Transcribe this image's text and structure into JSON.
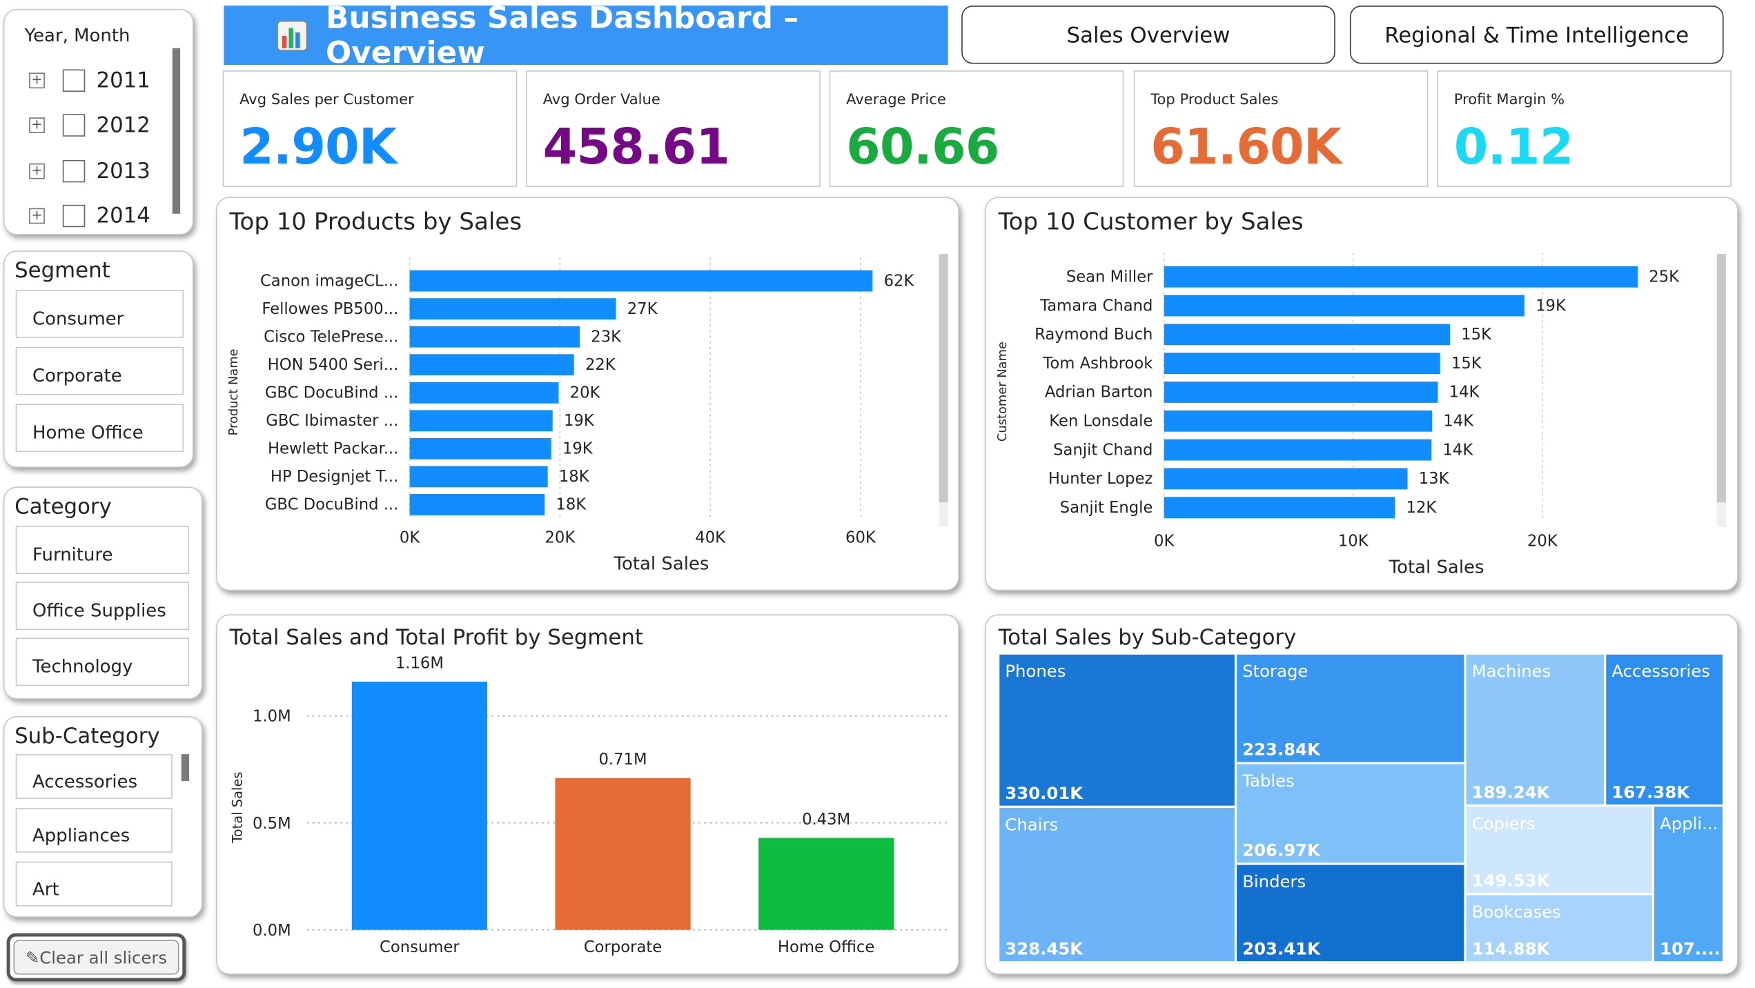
{
  "header": {
    "title": "Business Sales Dashboard – Overview",
    "title_icon": "bar-chart-icon",
    "nav_buttons": [
      "Sales Overview",
      "Regional & Time Intelligence"
    ]
  },
  "slicers": {
    "year_month": {
      "title": "Year, Month",
      "years": [
        "2011",
        "2012",
        "2013",
        "2014"
      ]
    },
    "segment": {
      "title": "Segment",
      "options": [
        "Consumer",
        "Corporate",
        "Home Office"
      ]
    },
    "category": {
      "title": "Category",
      "options": [
        "Furniture",
        "Office Supplies",
        "Technology"
      ]
    },
    "sub_category": {
      "title": "Sub-Category",
      "options": [
        "Accessories",
        "Appliances",
        "Art"
      ]
    },
    "clear_label": "Clear all slicers"
  },
  "kpis": [
    {
      "label": "Avg Sales per Customer",
      "value": "2.90K",
      "color": "#118dff"
    },
    {
      "label": "Avg Order Value",
      "value": "458.61",
      "color": "#750985"
    },
    {
      "label": "Average Price",
      "value": "60.66",
      "color": "#1aab40"
    },
    {
      "label": "Top Product Sales",
      "value": "61.60K",
      "color": "#e66c37"
    },
    {
      "label": "Profit Margin %",
      "value": "0.12",
      "color": "#1bd9f2"
    }
  ],
  "chart_data": [
    {
      "title": "Top 10 Products by Sales",
      "type": "bar",
      "orientation": "horizontal",
      "categories": [
        "Canon imageCL...",
        "Fellowes PB500...",
        "Cisco TelePrese...",
        "HON 5400 Seri...",
        "GBC DocuBind ...",
        "GBC Ibimaster ...",
        "Hewlett Packar...",
        "HP Designjet T...",
        "GBC DocuBind ..."
      ],
      "values": [
        61600,
        27453,
        22638,
        21871,
        19823,
        19025,
        18840,
        18374,
        17965
      ],
      "data_labels": [
        "62K",
        "27K",
        "23K",
        "22K",
        "20K",
        "19K",
        "19K",
        "18K",
        "18K"
      ],
      "xlabel": "Total Sales",
      "ylabel": "Product Name",
      "xlim": [
        0,
        70000
      ],
      "x_ticks": [
        "0K",
        "20K",
        "40K",
        "60K"
      ],
      "color": "#118dff"
    },
    {
      "title": "Top 10 Customer by Sales",
      "type": "bar",
      "orientation": "horizontal",
      "categories": [
        "Sean Miller",
        "Tamara Chand",
        "Raymond Buch",
        "Tom Ashbrook",
        "Adrian Barton",
        "Ken Lonsdale",
        "Sanjit Chand",
        "Hunter Lopez",
        "Sanjit Engle"
      ],
      "values": [
        25043,
        19052,
        15117,
        14596,
        14474,
        14175,
        14142,
        12873,
        12209
      ],
      "data_labels": [
        "25K",
        "19K",
        "15K",
        "15K",
        "14K",
        "14K",
        "14K",
        "13K",
        "12K"
      ],
      "xlabel": "Total Sales",
      "ylabel": "Customer Name",
      "xlim": [
        0,
        30000
      ],
      "x_ticks": [
        "0K",
        "10K",
        "20K"
      ],
      "color": "#118dff"
    },
    {
      "title": "Total Sales and Total Profit by Segment",
      "type": "bar",
      "orientation": "vertical",
      "categories": [
        "Consumer",
        "Corporate",
        "Home Office"
      ],
      "values": [
        1160000,
        710000,
        430000
      ],
      "data_labels": [
        "1.16M",
        "0.71M",
        "0.43M"
      ],
      "colors": [
        "#118dff",
        "#e66c37",
        "#0ebd40"
      ],
      "ylabel": "Total Sales",
      "ylim": [
        0,
        1250000
      ],
      "y_ticks": [
        {
          "value": 0,
          "label": "0.0M"
        },
        {
          "value": 500000,
          "label": "0.5M"
        },
        {
          "value": 1000000,
          "label": "1.0M"
        }
      ],
      "grid": true
    },
    {
      "title": "Total Sales by Sub-Category",
      "type": "treemap",
      "items": [
        {
          "name": "Phones",
          "value": "330.01K"
        },
        {
          "name": "Chairs",
          "value": "328.45K"
        },
        {
          "name": "Storage",
          "value": "223.84K"
        },
        {
          "name": "Tables",
          "value": "206.97K"
        },
        {
          "name": "Binders",
          "value": "203.41K"
        },
        {
          "name": "Machines",
          "value": "189.24K"
        },
        {
          "name": "Accessories",
          "value": "167.38K"
        },
        {
          "name": "Copiers",
          "value": "149.53K"
        },
        {
          "name": "Bookcases",
          "value": "114.88K"
        },
        {
          "name": "Appli...",
          "value": "107...."
        }
      ]
    }
  ]
}
